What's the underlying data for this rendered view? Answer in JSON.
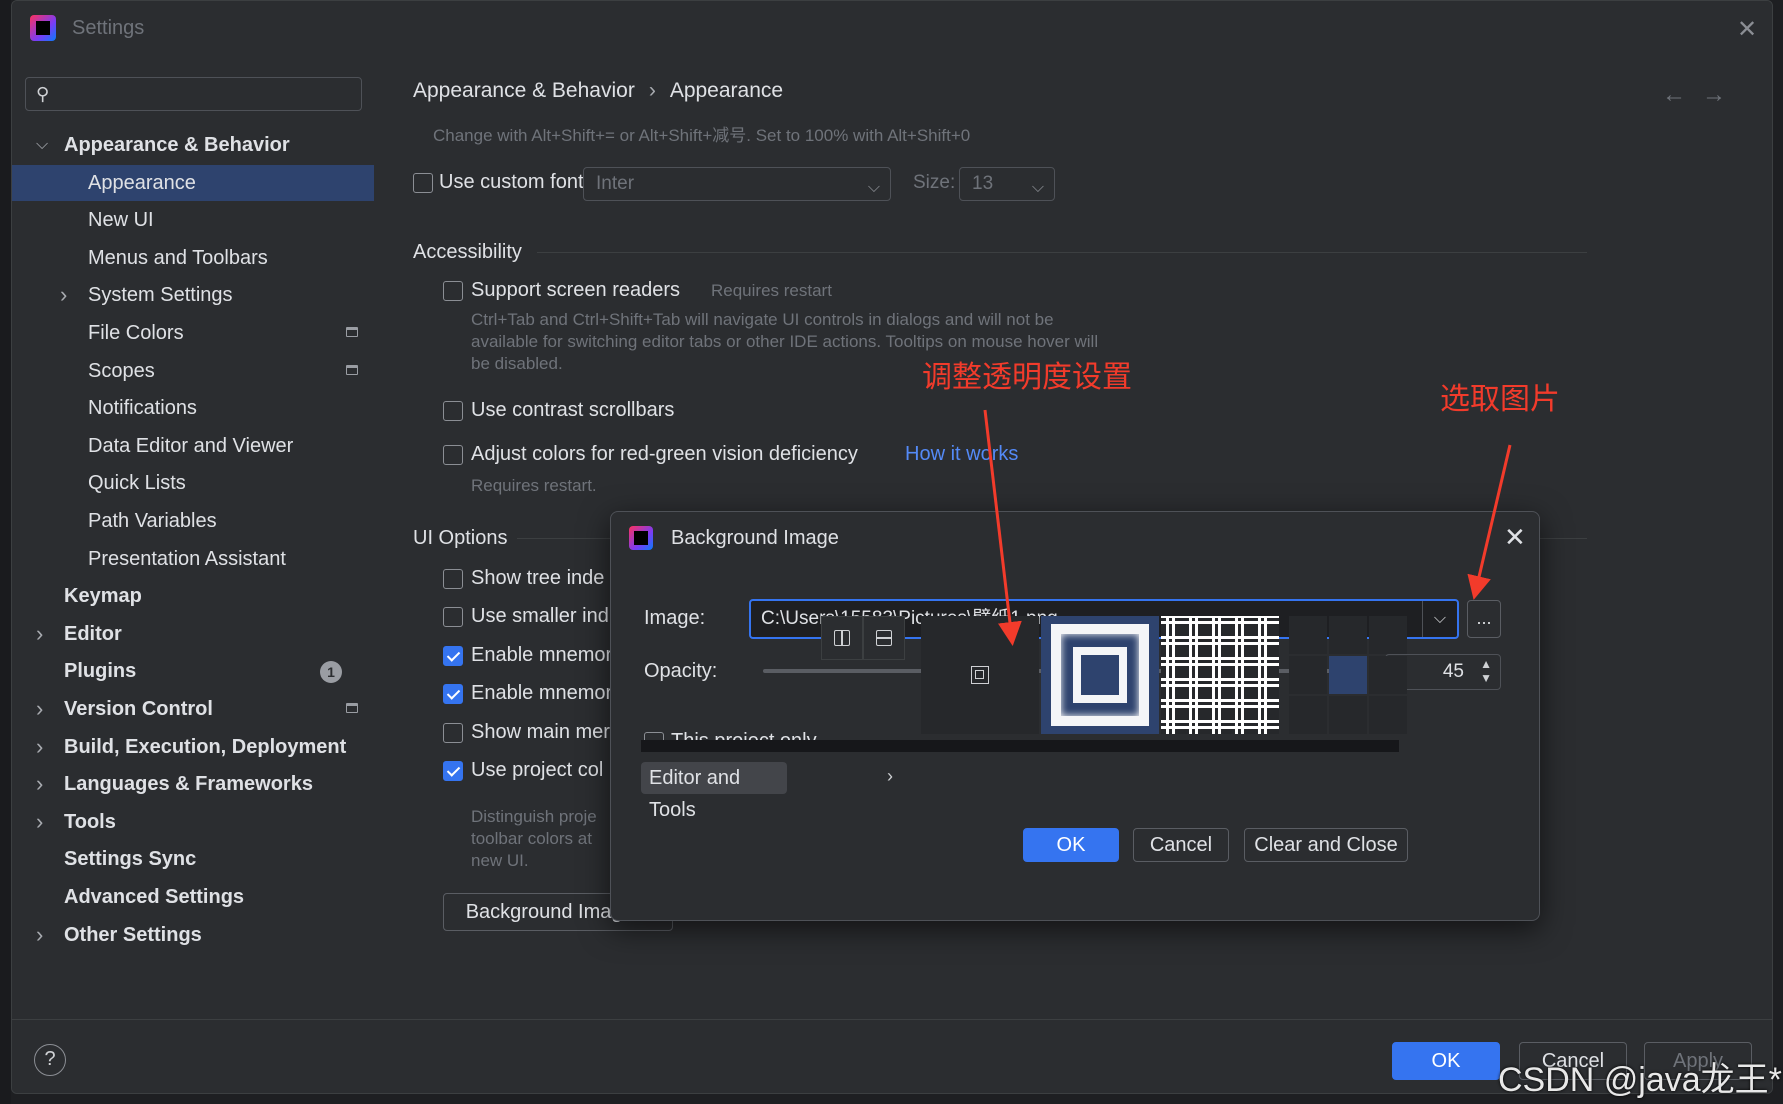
{
  "window": {
    "title": "Settings",
    "close_glyph": "✕"
  },
  "search": {
    "placeholder": "",
    "icon": "search-icon"
  },
  "sidebar": {
    "items": [
      {
        "label": "Appearance & Behavior",
        "level": 0,
        "expanded": true
      },
      {
        "label": "Appearance",
        "level": 1,
        "selected": true
      },
      {
        "label": "New UI",
        "level": 1
      },
      {
        "label": "Menus and Toolbars",
        "level": 1
      },
      {
        "label": "System Settings",
        "level": 1,
        "collapsed": true
      },
      {
        "label": "File Colors",
        "level": 1,
        "project_icon": true
      },
      {
        "label": "Scopes",
        "level": 1,
        "project_icon": true
      },
      {
        "label": "Notifications",
        "level": 1
      },
      {
        "label": "Data Editor and Viewer",
        "level": 1
      },
      {
        "label": "Quick Lists",
        "level": 1
      },
      {
        "label": "Path Variables",
        "level": 1
      },
      {
        "label": "Presentation Assistant",
        "level": 1
      },
      {
        "label": "Keymap",
        "level": 0
      },
      {
        "label": "Editor",
        "level": 0,
        "collapsed": true
      },
      {
        "label": "Plugins",
        "level": 0,
        "badge": "1"
      },
      {
        "label": "Version Control",
        "level": 0,
        "collapsed": true,
        "project_icon": true
      },
      {
        "label": "Build, Execution, Deployment",
        "level": 0,
        "collapsed": true
      },
      {
        "label": "Languages & Frameworks",
        "level": 0,
        "collapsed": true
      },
      {
        "label": "Tools",
        "level": 0,
        "collapsed": true
      },
      {
        "label": "Settings Sync",
        "level": 0
      },
      {
        "label": "Advanced Settings",
        "level": 0
      },
      {
        "label": "Other Settings",
        "level": 0,
        "collapsed": true
      }
    ]
  },
  "breadcrumb": {
    "parent": "Appearance & Behavior",
    "separator": "›",
    "current": "Appearance"
  },
  "nav": {
    "back": "←",
    "forward": "→"
  },
  "main": {
    "zoom_hint": "Change with Alt+Shift+= or Alt+Shift+减号. Set to 100% with Alt+Shift+0",
    "custom_font": {
      "label": "Use custom font:",
      "checked": false,
      "value": "Inter",
      "size_label": "Size:",
      "size_value": "13"
    },
    "accessibility": {
      "title": "Accessibility",
      "screen_readers": {
        "label": "Support screen readers",
        "note": "Requires restart",
        "checked": false,
        "desc1": "Ctrl+Tab and Ctrl+Shift+Tab will navigate UI controls in dialogs and will not be",
        "desc2": "available for switching editor tabs or other IDE actions. Tooltips on mouse hover will",
        "desc3": "be disabled."
      },
      "contrast_scrollbars": {
        "label": "Use contrast scrollbars",
        "checked": false
      },
      "color_deficiency": {
        "label": "Adjust colors for red-green vision deficiency",
        "link": "How it works",
        "checked": false,
        "note": "Requires restart."
      }
    },
    "ui_options": {
      "title": "UI Options",
      "items": [
        {
          "label": "Show tree inde",
          "checked": false
        },
        {
          "label": "Use smaller ind",
          "checked": false
        },
        {
          "label": "Enable mnemor",
          "checked": true
        },
        {
          "label": "Enable mnemor",
          "checked": true
        },
        {
          "label": "Show main mer",
          "checked": false
        },
        {
          "label": "Use project col",
          "checked": true
        }
      ],
      "desc1": "Distinguish proje",
      "desc2": "toolbar colors at",
      "desc3": "new UI.",
      "bg_image_button": "Background Image..."
    }
  },
  "footer": {
    "help": "?",
    "ok": "OK",
    "cancel": "Cancel",
    "apply": "Apply"
  },
  "dialog": {
    "title": "Background Image",
    "close_glyph": "✕",
    "image_label": "Image:",
    "image_path": "C:\\Users\\15583\\Pictures\\壁纸1.png",
    "browse_label": "...",
    "opacity_label": "Opacity:",
    "opacity_value": "45",
    "opacity_fraction": 0.45,
    "project_only": {
      "label": "This project only",
      "checked": false
    },
    "target": "Editor and Tools",
    "ok": "OK",
    "cancel": "Cancel",
    "clear_close": "Clear and Close"
  },
  "annotations": {
    "opacity_note": "调整透明度设置",
    "browse_note": "选取图片"
  },
  "watermark": "CSDN @java龙王*",
  "colors": {
    "accent": "#3574f0",
    "selection": "#2e436e",
    "annotation": "#f23b2b",
    "link": "#548af7"
  }
}
